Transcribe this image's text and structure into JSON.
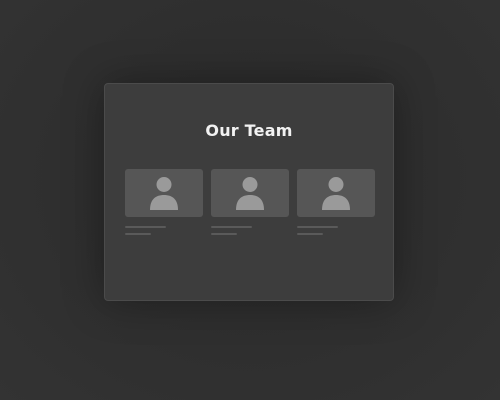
{
  "panel": {
    "title": "Our Team"
  },
  "team": {
    "members": [
      {
        "avatar_icon": "person-icon"
      },
      {
        "avatar_icon": "person-icon"
      },
      {
        "avatar_icon": "person-icon"
      }
    ]
  },
  "colors": {
    "background": "#2e2e2e",
    "panel": "#3d3d3d",
    "card": "#565656",
    "avatar": "#9a9a9a",
    "title": "#f2f2f2",
    "placeholder_line": "#5a5a5a"
  }
}
